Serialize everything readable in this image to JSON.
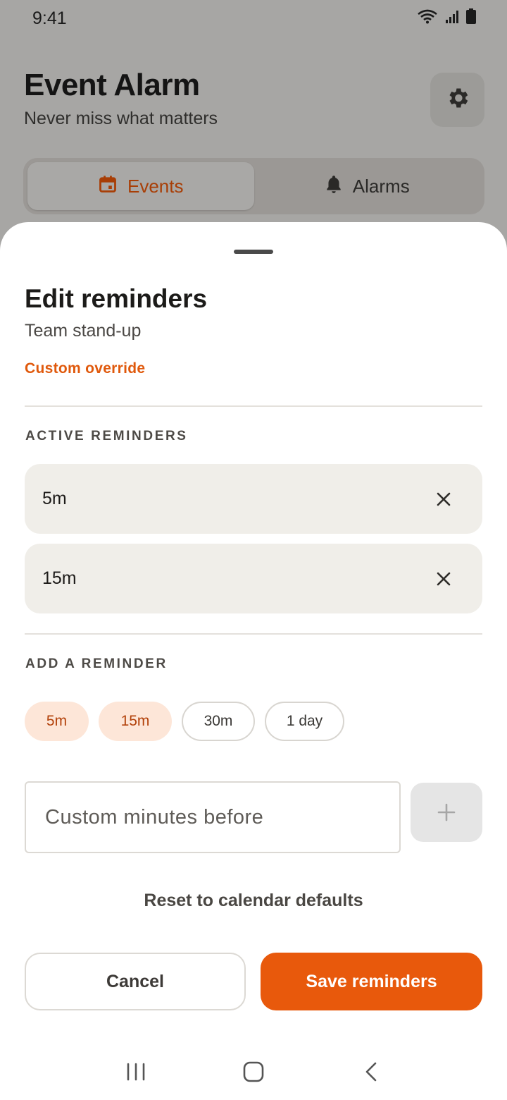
{
  "status_bar": {
    "time": "9:41"
  },
  "header": {
    "title": "Event Alarm",
    "subtitle": "Never miss what matters"
  },
  "tabs": [
    {
      "label": "Events",
      "icon": "calendar-icon",
      "active": true
    },
    {
      "label": "Alarms",
      "icon": "bell-icon",
      "active": false
    }
  ],
  "sheet": {
    "title": "Edit reminders",
    "event_name": "Team stand-up",
    "override_label": "Custom override",
    "active_section_label": "ACTIVE REMINDERS",
    "active_reminders": [
      {
        "label": "5m"
      },
      {
        "label": "15m"
      }
    ],
    "add_section_label": "ADD A REMINDER",
    "presets": [
      {
        "label": "5m",
        "selected": true
      },
      {
        "label": "15m",
        "selected": true
      },
      {
        "label": "30m",
        "selected": false
      },
      {
        "label": "1 day",
        "selected": false
      }
    ],
    "custom_input": {
      "placeholder": "Custom minutes before",
      "value": ""
    },
    "reset_label": "Reset to calendar defaults",
    "cancel_label": "Cancel",
    "save_label": "Save reminders"
  },
  "colors": {
    "accent": "#e8590c",
    "accent_soft": "#fde6d8",
    "row_bg": "#f0eee9",
    "scrim": "#a7a6a4"
  }
}
